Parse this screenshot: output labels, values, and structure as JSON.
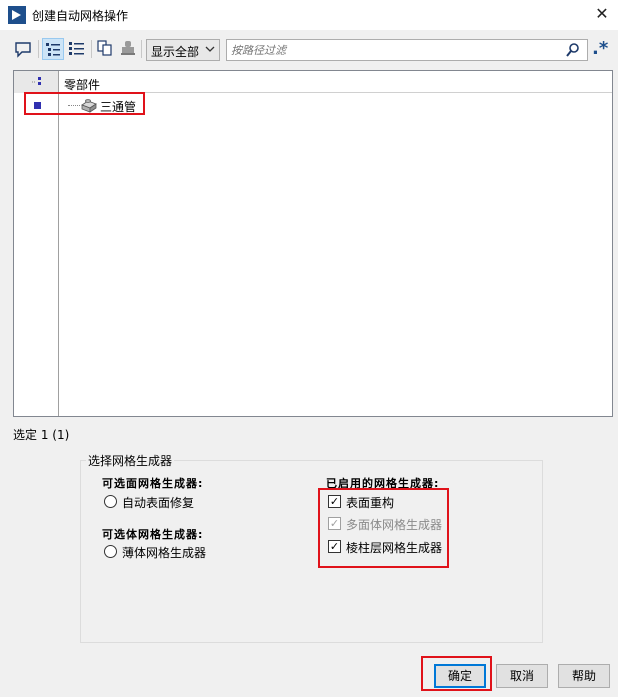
{
  "window": {
    "title": "创建自动网格操作",
    "close_glyph": "✕"
  },
  "toolbar": {
    "filter_select": "显示全部",
    "search_placeholder": "按路径过滤",
    "star_glyph": ".*",
    "icons": [
      "comment-icon",
      "tree-view-icon",
      "list-view-icon",
      "copy-icon",
      "stamp-icon",
      "search-icon",
      "regex-icon"
    ]
  },
  "tree": {
    "column_header": "零部件",
    "rows": [
      {
        "label": "三通管",
        "icon": "part-icon"
      }
    ]
  },
  "status": {
    "selected": "选定 1 (1)"
  },
  "mesher_group": {
    "title": "选择网格生成器",
    "surface_heading": "可选面网格生成器:",
    "surface_options": [
      {
        "label": "自动表面修复",
        "selected": false
      }
    ],
    "volume_heading": "可选体网格生成器:",
    "volume_options": [
      {
        "label": "薄体网格生成器",
        "selected": false
      }
    ],
    "enabled_heading": "已启用的网格生成器:",
    "enabled_meshers": [
      {
        "label": "表面重构",
        "checked": true,
        "disabled": false
      },
      {
        "label": "多面体网格生成器",
        "checked": true,
        "disabled": true
      },
      {
        "label": "棱柱层网格生成器",
        "checked": true,
        "disabled": false
      }
    ]
  },
  "buttons": {
    "ok": "确定",
    "cancel": "取消",
    "help": "帮助"
  },
  "colors": {
    "highlight_red": "#e0121a",
    "accent_blue": "#0078d7",
    "app_icon": "#1e4f8c"
  }
}
